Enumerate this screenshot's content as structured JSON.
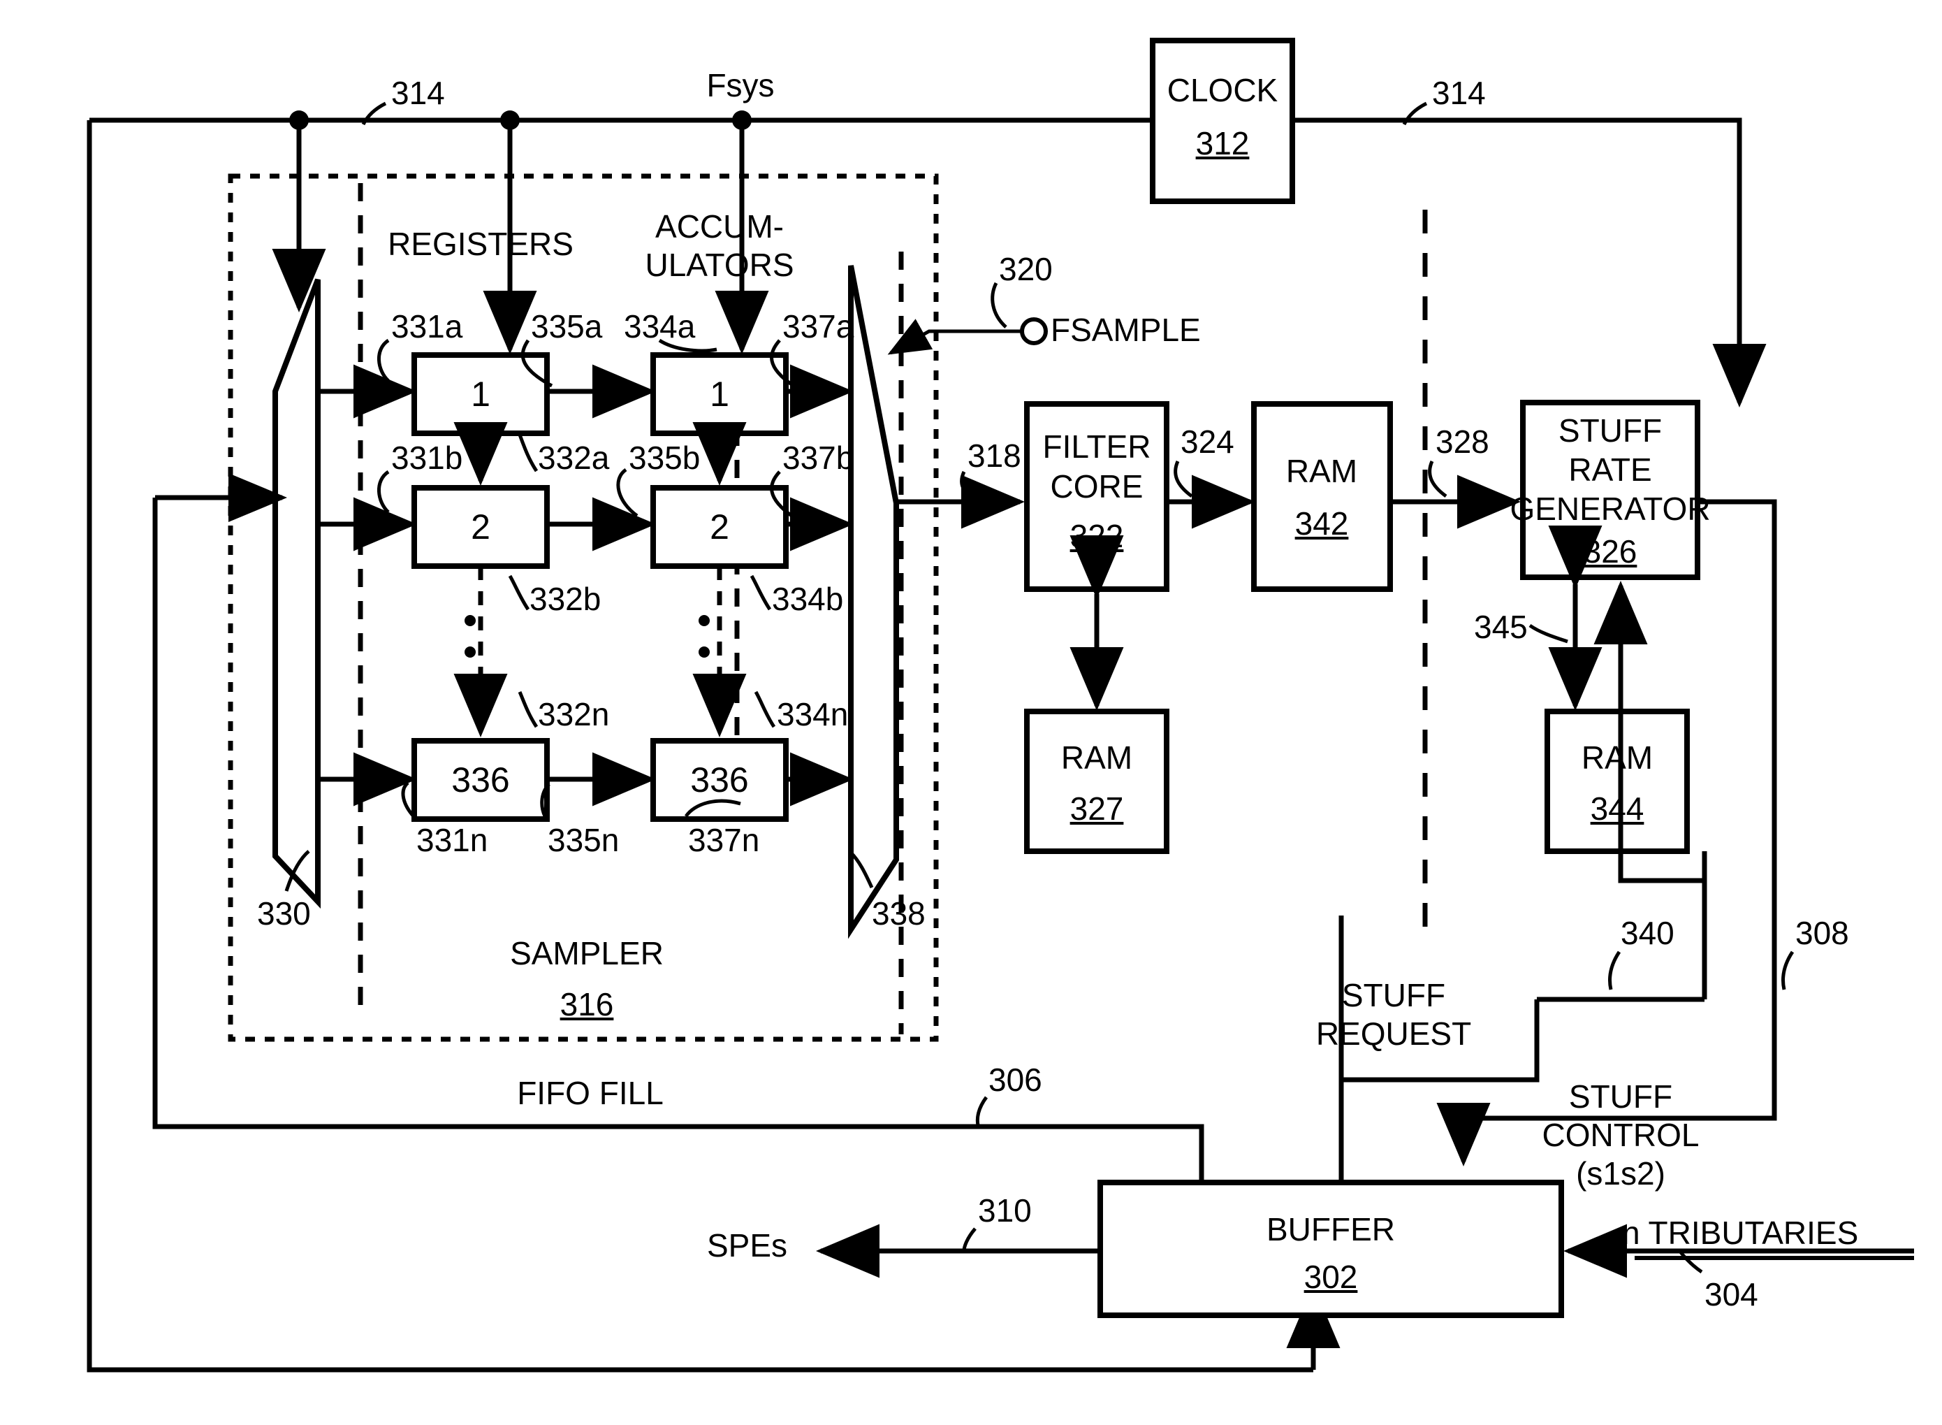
{
  "figure": {
    "type": "patent-block-diagram",
    "description": "Block diagram of a sampler, filter core and stuff rate generator for tributary mapping"
  },
  "blocks": {
    "clock": {
      "title": "CLOCK",
      "number": "312"
    },
    "filter_core": {
      "title_line1": "FILTER",
      "title_line2": "CORE",
      "number": "322"
    },
    "ram_327": {
      "title": "RAM",
      "number": "327"
    },
    "ram_342": {
      "title": "RAM",
      "number": "342"
    },
    "ram_344": {
      "title": "RAM",
      "number": "344"
    },
    "stuff_rate_generator": {
      "title_line1": "STUFF",
      "title_line2": "RATE",
      "title_line3": "GENERATOR",
      "number": "326"
    },
    "buffer": {
      "title": "BUFFER",
      "number": "302"
    },
    "sampler": {
      "title": "SAMPLER",
      "number": "316"
    }
  },
  "column_headers": {
    "registers": "REGISTERS",
    "accumulators_line1": "ACCUM-",
    "accumulators_line2": "ULATORS"
  },
  "registers": [
    {
      "label": "1"
    },
    {
      "label": "2"
    },
    {
      "label": "336"
    }
  ],
  "accumulators": [
    {
      "label": "1"
    },
    {
      "label": "2"
    },
    {
      "label": "336"
    }
  ],
  "signals": {
    "fsys": "Fsys",
    "fsample": "FSAMPLE",
    "spes": "SPEs",
    "fifo_fill": "FIFO FILL",
    "stuff_request_line1": "STUFF",
    "stuff_request_line2": "REQUEST",
    "stuff_control_line1": "STUFF",
    "stuff_control_line2": "CONTROL",
    "stuff_control_line3": "(s1s2)",
    "n_tributaries": "n TRIBUTARIES"
  },
  "reference_numerals": {
    "clock_bus_left": "314",
    "clock_bus_right": "314",
    "mux_in": "330",
    "mux_out": "338",
    "fsample_ref": "320",
    "filter_in": "318",
    "filter_out": "324",
    "ram342_out": "328",
    "srg_ram_link": "345",
    "stuff_request_ref": "340",
    "stuff_control_ref": "308",
    "fifo_fill_ref": "306",
    "spes_ref": "310",
    "tributaries_ref": "304",
    "reg_in": [
      "331a",
      "331b",
      "331n"
    ],
    "reg_clk": [
      "332a",
      "332b",
      "332n"
    ],
    "reg_out": [
      "335a",
      "335b",
      "335n"
    ],
    "acc_clk": [
      "334a",
      "334b",
      "334n"
    ],
    "acc_out": [
      "337a",
      "337b",
      "337n"
    ]
  },
  "colors": {
    "line": "#000000",
    "background": "#ffffff"
  }
}
